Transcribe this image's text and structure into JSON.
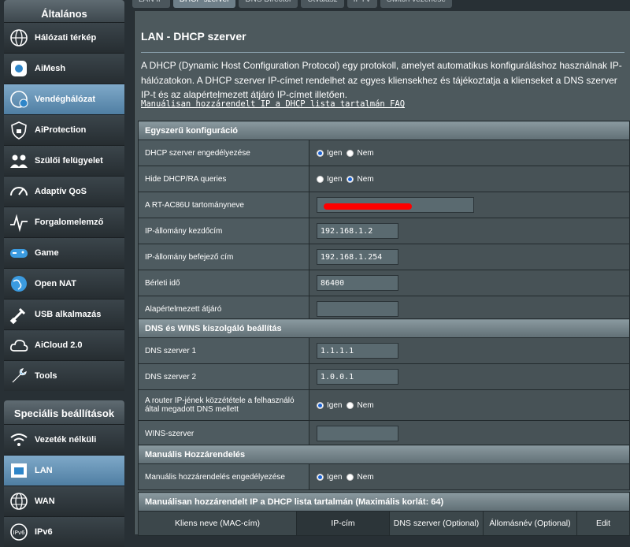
{
  "tabs": [
    "LAN IP",
    "DHCP szerver",
    "DNS Director",
    "Útválasz",
    "IPTV",
    "Switch vezérlése"
  ],
  "sidebar": {
    "general_header": "Általános",
    "general_items": [
      {
        "label": "Hálózati térkép",
        "icon": "network-map-icon"
      },
      {
        "label": "AiMesh",
        "icon": "aimesh-icon"
      },
      {
        "label": "Vendéghálózat",
        "icon": "guest-network-icon",
        "active": true
      },
      {
        "label": "AiProtection",
        "icon": "shield-lock-icon"
      },
      {
        "label": "Szülői felügyelet",
        "icon": "parental-control-icon"
      },
      {
        "label": "Adaptív QoS",
        "icon": "speedometer-icon"
      },
      {
        "label": "Forgalomelemző",
        "icon": "traffic-analyzer-icon"
      },
      {
        "label": "Game",
        "icon": "gamepad-icon"
      },
      {
        "label": "Open NAT",
        "icon": "globe-icon"
      },
      {
        "label": "USB alkalmazás",
        "icon": "usb-icon"
      },
      {
        "label": "AiCloud 2.0",
        "icon": "cloud-icon"
      },
      {
        "label": "Tools",
        "icon": "wrench-icon"
      }
    ],
    "advanced_header": "Speciális beállítások",
    "advanced_items": [
      {
        "label": "Vezeték nélküli",
        "icon": "wifi-icon"
      },
      {
        "label": "LAN",
        "icon": "lan-icon",
        "active": true
      },
      {
        "label": "WAN",
        "icon": "wan-globe-icon"
      },
      {
        "label": "IPv6",
        "icon": "ipv6-icon"
      }
    ]
  },
  "main": {
    "title": "LAN - DHCP szerver",
    "description": "A DHCP (Dynamic Host Configuration Protocol) egy protokoll, amelyet automatikus konfiguráláshoz használnak IP-hálózatokon. A DHCP szerver IP-címet rendelhet az egyes kliensekhez és tájékoztatja a klienseket a DNS szerver IP-t és az alapértelmezett átjáró IP-címet illetően.",
    "faq_link": "Manuálisan hozzárendelt IP a DHCP lista tartalmán FAQ",
    "yes": "Igen",
    "no": "Nem",
    "basic": {
      "header": "Egyszerű konfiguráció",
      "enable_dhcp": "DHCP szerver engedélyezése",
      "hide_dhcp_ra": "Hide DHCP/RA queries",
      "domain_name": "A RT-AC86U tartományneve",
      "start_ip_label": "IP-állomány kezdőcím",
      "start_ip": "192.168.1.2",
      "end_ip_label": "IP-állomány befejező cím",
      "end_ip": "192.168.1.254",
      "lease_label": "Bérleti idő",
      "lease": "86400",
      "gateway_label": "Alapértelmezett átjáró",
      "gateway": ""
    },
    "dns": {
      "header": "DNS és WINS kiszolgáló beállítás",
      "dns1_label": "DNS szerver 1",
      "dns1": "1.1.1.1",
      "dns2_label": "DNS szerver 2",
      "dns2": "1.0.0.1",
      "advertise_label": "A router IP-jének közzététele a felhasználó által megadott DNS mellett",
      "wins_label": "WINS-szerver",
      "wins": ""
    },
    "manual": {
      "header": "Manuális Hozzárendelés",
      "enable_label": "Manuális hozzárendelés engedélyezése"
    },
    "list": {
      "header": "Manuálisan hozzárendelt IP a DHCP lista tartalmán (Maximális korlát: 64)",
      "columns": [
        "Kliens neve (MAC-cím)",
        "IP-cím",
        "DNS szerver (Optional)",
        "Állomásnév (Optional)",
        "Edit"
      ]
    }
  }
}
